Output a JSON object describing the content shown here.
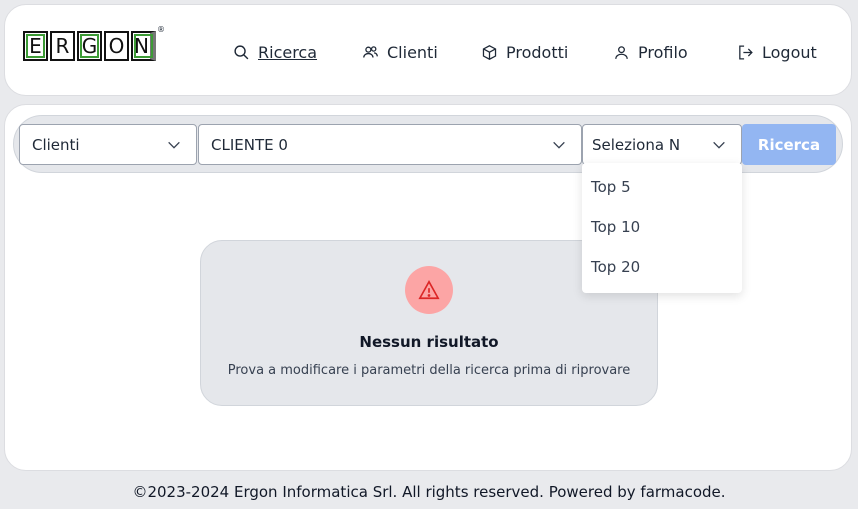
{
  "header": {
    "logo_letters": [
      "E",
      "R",
      "G",
      "O",
      "N"
    ],
    "logo_mark": "®",
    "nav": [
      {
        "label": "Ricerca",
        "icon": "search-icon"
      },
      {
        "label": "Clienti",
        "icon": "users-icon"
      },
      {
        "label": "Prodotti",
        "icon": "box-icon"
      },
      {
        "label": "Profilo",
        "icon": "user-icon"
      },
      {
        "label": "Logout",
        "icon": "logout-icon"
      }
    ]
  },
  "search": {
    "type_select": "Clienti",
    "client_select": "CLIENTE 0",
    "top_select": "Seleziona N",
    "button_label": "Ricerca",
    "top_options": [
      "Top 5",
      "Top 10",
      "Top 20"
    ]
  },
  "empty_state": {
    "title": "Nessun risultato",
    "message": "Prova a modificare i parametri della ricerca prima di riprovare"
  },
  "footer": {
    "text": "©2023-2024 Ergon Informatica Srl. All rights reserved. Powered by farmacode."
  },
  "colors": {
    "accent": "#93b6f2",
    "warning": "#fca5a5",
    "logo_green": "#3c9b35"
  }
}
